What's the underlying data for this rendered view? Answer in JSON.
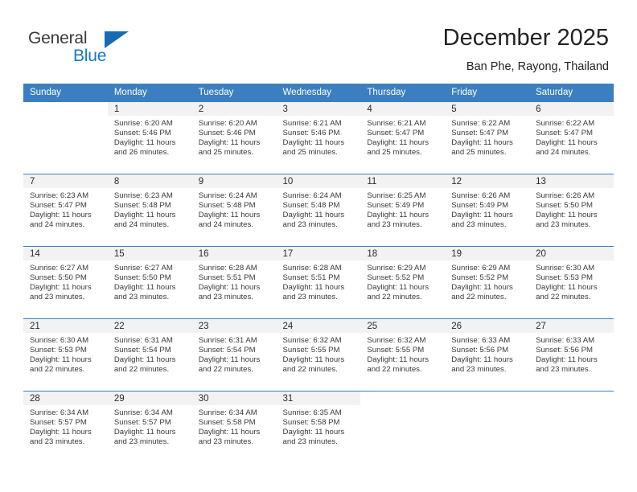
{
  "logo": {
    "word_one": "General",
    "word_two": "Blue",
    "triangle_icon": "triangle-icon",
    "brand_color": "#1878c8"
  },
  "header": {
    "title": "December 2025",
    "subtitle": "Ban Phe, Rayong, Thailand"
  },
  "theme": {
    "header_bg": "#3c7fc0",
    "header_text": "#ffffff",
    "daynum_bg": "#f2f2f2",
    "body_text": "#3a3a3a"
  },
  "calendar": {
    "weekday_headers": [
      "Sunday",
      "Monday",
      "Tuesday",
      "Wednesday",
      "Thursday",
      "Friday",
      "Saturday"
    ],
    "weeks": [
      [
        {
          "day": "",
          "detail": ""
        },
        {
          "day": "1",
          "detail": "Sunrise: 6:20 AM\nSunset: 5:46 PM\nDaylight: 11 hours\nand 26 minutes."
        },
        {
          "day": "2",
          "detail": "Sunrise: 6:20 AM\nSunset: 5:46 PM\nDaylight: 11 hours\nand 25 minutes."
        },
        {
          "day": "3",
          "detail": "Sunrise: 6:21 AM\nSunset: 5:46 PM\nDaylight: 11 hours\nand 25 minutes."
        },
        {
          "day": "4",
          "detail": "Sunrise: 6:21 AM\nSunset: 5:47 PM\nDaylight: 11 hours\nand 25 minutes."
        },
        {
          "day": "5",
          "detail": "Sunrise: 6:22 AM\nSunset: 5:47 PM\nDaylight: 11 hours\nand 25 minutes."
        },
        {
          "day": "6",
          "detail": "Sunrise: 6:22 AM\nSunset: 5:47 PM\nDaylight: 11 hours\nand 24 minutes."
        }
      ],
      [
        {
          "day": "7",
          "detail": "Sunrise: 6:23 AM\nSunset: 5:47 PM\nDaylight: 11 hours\nand 24 minutes."
        },
        {
          "day": "8",
          "detail": "Sunrise: 6:23 AM\nSunset: 5:48 PM\nDaylight: 11 hours\nand 24 minutes."
        },
        {
          "day": "9",
          "detail": "Sunrise: 6:24 AM\nSunset: 5:48 PM\nDaylight: 11 hours\nand 24 minutes."
        },
        {
          "day": "10",
          "detail": "Sunrise: 6:24 AM\nSunset: 5:48 PM\nDaylight: 11 hours\nand 23 minutes."
        },
        {
          "day": "11",
          "detail": "Sunrise: 6:25 AM\nSunset: 5:49 PM\nDaylight: 11 hours\nand 23 minutes."
        },
        {
          "day": "12",
          "detail": "Sunrise: 6:26 AM\nSunset: 5:49 PM\nDaylight: 11 hours\nand 23 minutes."
        },
        {
          "day": "13",
          "detail": "Sunrise: 6:26 AM\nSunset: 5:50 PM\nDaylight: 11 hours\nand 23 minutes."
        }
      ],
      [
        {
          "day": "14",
          "detail": "Sunrise: 6:27 AM\nSunset: 5:50 PM\nDaylight: 11 hours\nand 23 minutes."
        },
        {
          "day": "15",
          "detail": "Sunrise: 6:27 AM\nSunset: 5:50 PM\nDaylight: 11 hours\nand 23 minutes."
        },
        {
          "day": "16",
          "detail": "Sunrise: 6:28 AM\nSunset: 5:51 PM\nDaylight: 11 hours\nand 23 minutes."
        },
        {
          "day": "17",
          "detail": "Sunrise: 6:28 AM\nSunset: 5:51 PM\nDaylight: 11 hours\nand 23 minutes."
        },
        {
          "day": "18",
          "detail": "Sunrise: 6:29 AM\nSunset: 5:52 PM\nDaylight: 11 hours\nand 22 minutes."
        },
        {
          "day": "19",
          "detail": "Sunrise: 6:29 AM\nSunset: 5:52 PM\nDaylight: 11 hours\nand 22 minutes."
        },
        {
          "day": "20",
          "detail": "Sunrise: 6:30 AM\nSunset: 5:53 PM\nDaylight: 11 hours\nand 22 minutes."
        }
      ],
      [
        {
          "day": "21",
          "detail": "Sunrise: 6:30 AM\nSunset: 5:53 PM\nDaylight: 11 hours\nand 22 minutes."
        },
        {
          "day": "22",
          "detail": "Sunrise: 6:31 AM\nSunset: 5:54 PM\nDaylight: 11 hours\nand 22 minutes."
        },
        {
          "day": "23",
          "detail": "Sunrise: 6:31 AM\nSunset: 5:54 PM\nDaylight: 11 hours\nand 22 minutes."
        },
        {
          "day": "24",
          "detail": "Sunrise: 6:32 AM\nSunset: 5:55 PM\nDaylight: 11 hours\nand 22 minutes."
        },
        {
          "day": "25",
          "detail": "Sunrise: 6:32 AM\nSunset: 5:55 PM\nDaylight: 11 hours\nand 22 minutes."
        },
        {
          "day": "26",
          "detail": "Sunrise: 6:33 AM\nSunset: 5:56 PM\nDaylight: 11 hours\nand 23 minutes."
        },
        {
          "day": "27",
          "detail": "Sunrise: 6:33 AM\nSunset: 5:56 PM\nDaylight: 11 hours\nand 23 minutes."
        }
      ],
      [
        {
          "day": "28",
          "detail": "Sunrise: 6:34 AM\nSunset: 5:57 PM\nDaylight: 11 hours\nand 23 minutes."
        },
        {
          "day": "29",
          "detail": "Sunrise: 6:34 AM\nSunset: 5:57 PM\nDaylight: 11 hours\nand 23 minutes."
        },
        {
          "day": "30",
          "detail": "Sunrise: 6:34 AM\nSunset: 5:58 PM\nDaylight: 11 hours\nand 23 minutes."
        },
        {
          "day": "31",
          "detail": "Sunrise: 6:35 AM\nSunset: 5:58 PM\nDaylight: 11 hours\nand 23 minutes."
        },
        {
          "day": "",
          "detail": ""
        },
        {
          "day": "",
          "detail": ""
        },
        {
          "day": "",
          "detail": ""
        }
      ]
    ]
  }
}
